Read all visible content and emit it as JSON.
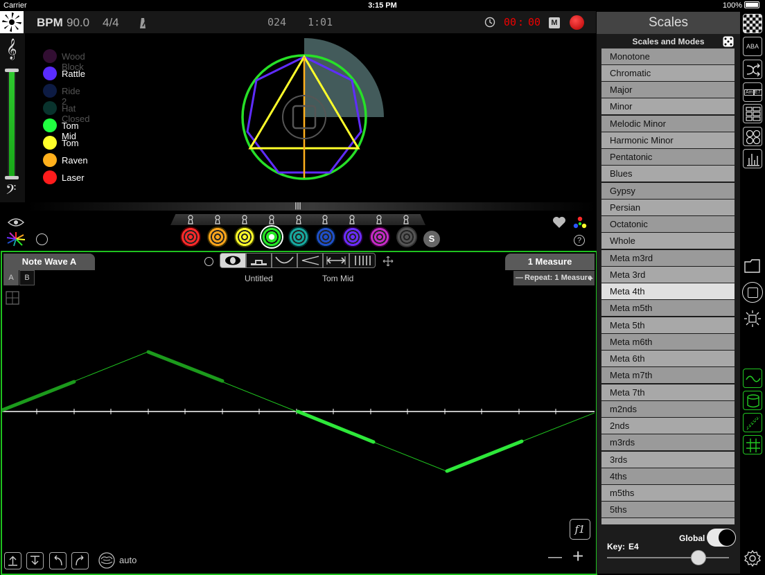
{
  "status": {
    "carrier": "Carrier",
    "time": "3:15 PM",
    "battery": "100%"
  },
  "topbar": {
    "bpm_label": "BPM",
    "bpm": "90.0",
    "meter": "4/4",
    "bar": "024",
    "beat": "1:01",
    "timer_min": "00",
    "timer_sep": ":",
    "timer_sec": "00",
    "m_button": "M"
  },
  "instruments": [
    {
      "name": "Wood Block",
      "color": "#9b2c9b",
      "active": false
    },
    {
      "name": "Rattle",
      "color": "#5a2cff",
      "active": true
    },
    {
      "name": "Ride 2",
      "color": "#1b3a8a",
      "active": false
    },
    {
      "name": "Hat Closed",
      "color": "#1c8f7f",
      "active": false
    },
    {
      "name": "Tom Mid",
      "color": "#20ff40",
      "active": true
    },
    {
      "name": "Tom",
      "color": "#ffff2a",
      "active": true
    },
    {
      "name": "Raven",
      "color": "#ffb01c",
      "active": true
    },
    {
      "name": "Laser",
      "color": "#ff1c1c",
      "active": true
    }
  ],
  "sound_buttons": [
    {
      "color": "#ff2a2a"
    },
    {
      "color": "#ffa51c"
    },
    {
      "color": "#ffff2a"
    },
    {
      "color": "#25e825"
    },
    {
      "color": "#17a89e"
    },
    {
      "color": "#1f4fc8"
    },
    {
      "color": "#6a2cff"
    },
    {
      "color": "#c42ac4"
    },
    {
      "color": "#555555"
    }
  ],
  "s_button": "S",
  "editor": {
    "wave_name": "Note Wave A",
    "tab_a": "A",
    "tab_b": "B",
    "label_left": "Untitled",
    "label_right": "Tom Mid",
    "measure": "1 Measure",
    "repeat": "Repeat: 1 Measure",
    "repeat_minus": "—",
    "repeat_plus": "+",
    "auto": "auto",
    "f1": "f1",
    "minus": "—",
    "plus": "+"
  },
  "scales_panel": {
    "title": "Scales",
    "subtitle": "Scales and Modes",
    "selected": "Meta 4th",
    "items": [
      "Monotone",
      "Chromatic",
      "Major",
      "Minor",
      "Melodic Minor",
      "Harmonic Minor",
      "Pentatonic",
      "Blues",
      "Gypsy",
      "Persian",
      "Octatonic",
      "Whole",
      "Meta m3rd",
      "Meta 3rd",
      "Meta 4th",
      "Meta m5th",
      "Meta 5th",
      "Meta m6th",
      "Meta 6th",
      "Meta m7th",
      "Meta 7th",
      "m2nds",
      "2nds",
      "m3rds",
      "3rds",
      "4ths",
      "m5ths",
      "5ths"
    ],
    "global_label": "Global",
    "key_label": "Key:",
    "key_value": "E4"
  },
  "right_toolbar_text": {
    "chord_a": "Am",
    "chord_b": "E7",
    "aba": "ABA"
  }
}
